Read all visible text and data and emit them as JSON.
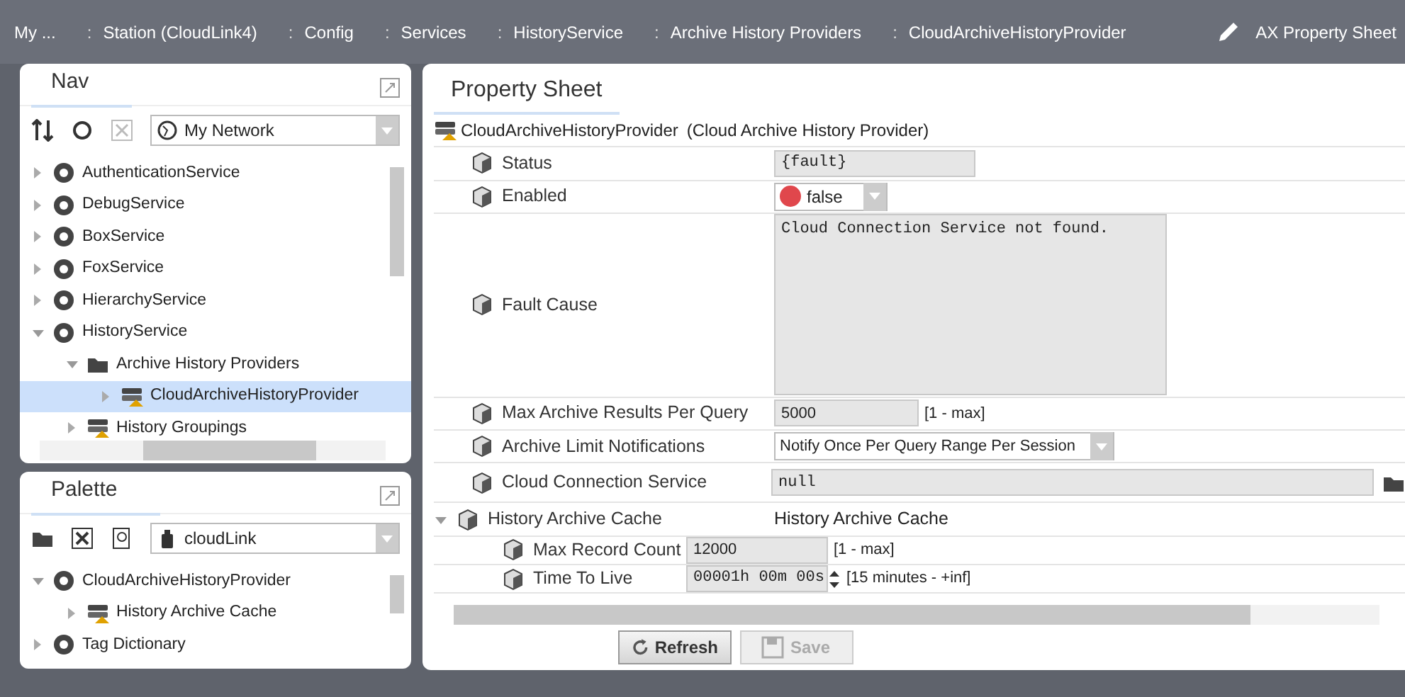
{
  "breadcrumb": [
    "My ...",
    "Station (CloudLink4)",
    "Config",
    "Services",
    "HistoryService",
    "Archive History Providers",
    "CloudArchiveHistoryProvider"
  ],
  "breadcrumb_separator": ":",
  "view_selector": "AX Property Sheet",
  "nav": {
    "title": "Nav",
    "network": "My Network",
    "tree": [
      {
        "label": "AuthenticationService",
        "expanded": false,
        "selected": false
      },
      {
        "label": "DebugService",
        "expanded": false,
        "selected": false
      },
      {
        "label": "BoxService",
        "expanded": false,
        "selected": false
      },
      {
        "label": "FoxService",
        "expanded": false,
        "selected": false
      },
      {
        "label": "HierarchyService",
        "expanded": false,
        "selected": false
      },
      {
        "label": "HistoryService",
        "expanded": true,
        "selected": false,
        "children": [
          {
            "label": "Archive History Providers",
            "expanded": true,
            "selected": false,
            "children": [
              {
                "label": "CloudArchiveHistoryProvider",
                "expanded": false,
                "selected": true
              }
            ]
          },
          {
            "label": "History Groupings",
            "expanded": false,
            "selected": false
          }
        ]
      }
    ]
  },
  "palette": {
    "title": "Palette",
    "module": "cloudLink",
    "tree": [
      {
        "label": "CloudArchiveHistoryProvider",
        "expanded": true,
        "selected": false,
        "children": [
          {
            "label": "History Archive Cache",
            "expanded": false,
            "selected": false
          }
        ]
      },
      {
        "label": "Tag Dictionary",
        "expanded": false,
        "selected": false
      }
    ]
  },
  "property_sheet": {
    "tab": "Property Sheet",
    "component": "CloudArchiveHistoryProvider",
    "display_name": "(Cloud Archive History Provider)",
    "properties": [
      {
        "kind": "readonly",
        "label": "Status",
        "value": "{fault}"
      },
      {
        "kind": "boolean",
        "label": "Enabled",
        "value": "false",
        "color": "#e0474c"
      },
      {
        "kind": "textarea",
        "label": "Fault Cause",
        "value": "Cloud Connection Service not found."
      },
      {
        "kind": "number",
        "label": "Max Archive Results Per Query",
        "value": "5000",
        "range": "[1 - max]"
      },
      {
        "kind": "select",
        "label": "Archive Limit Notifications",
        "value": "Notify Once Per Query Range Per Session"
      },
      {
        "kind": "ord",
        "label": "Cloud Connection Service",
        "value": "null"
      },
      {
        "kind": "group",
        "label": "History Archive Cache",
        "value": "History Archive Cache",
        "expanded": true,
        "children": [
          {
            "kind": "number",
            "label": "Max Record Count",
            "value": "12000",
            "range": "[1 - max]"
          },
          {
            "kind": "reltime",
            "label": "Time To Live",
            "value": "00001h 00m 00s",
            "range": "[15 minutes - +inf]"
          }
        ]
      }
    ]
  },
  "buttons": [
    {
      "label": "Refresh",
      "disabled": false
    },
    {
      "label": "Save",
      "disabled": true
    }
  ]
}
